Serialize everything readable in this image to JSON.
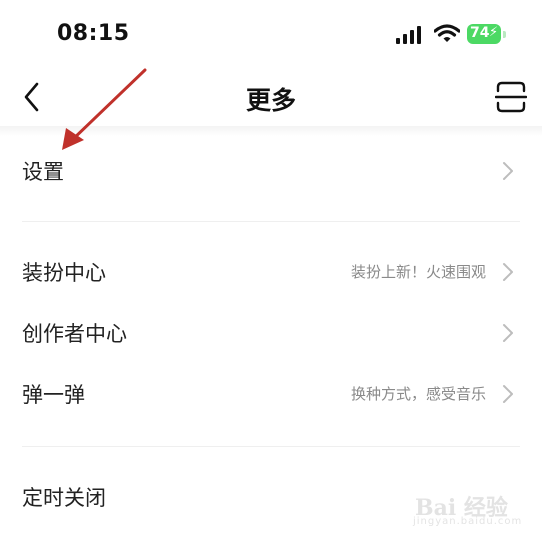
{
  "status_bar": {
    "time": "08:15",
    "battery_level": "74",
    "battery_color": "#4cd964"
  },
  "header": {
    "title": "更多",
    "back_icon": "chevron-left-icon",
    "right_icon": "scan-icon"
  },
  "menu_groups": [
    {
      "items": [
        {
          "label": "设置",
          "subtitle": ""
        }
      ]
    },
    {
      "items": [
        {
          "label": "装扮中心",
          "subtitle": "装扮上新！火速围观"
        },
        {
          "label": "创作者中心",
          "subtitle": ""
        },
        {
          "label": "弹一弹",
          "subtitle": "换种方式，感受音乐"
        }
      ]
    },
    {
      "items": [
        {
          "label": "定时关闭",
          "subtitle": ""
        }
      ]
    }
  ],
  "watermark": {
    "text": "Bai 经验",
    "url_text": "jingyan.baidu.com"
  },
  "annotation_color": "#c0312b"
}
